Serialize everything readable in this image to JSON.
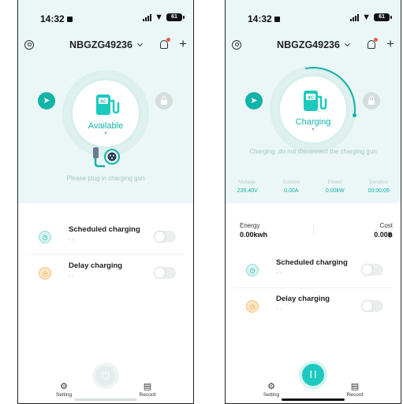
{
  "colors": {
    "accent": "#12b3a8",
    "hero_bg": "#eaf7f6",
    "disabled": "#d5dedd",
    "warning": "#f0a23a"
  },
  "left": {
    "status": {
      "time": "14:32",
      "battery": "61"
    },
    "header": {
      "device": "NBGZG49236"
    },
    "state": {
      "label": "Available",
      "badge": "AC",
      "hint": "Please plug in charging gun"
    },
    "rows": [
      {
        "title": "Scheduled charging",
        "sub": "- -",
        "icon": "clock-icon"
      },
      {
        "title": "Delay charging",
        "sub": "- -",
        "icon": "timer-icon"
      }
    ],
    "tabs": {
      "setting": "Setting",
      "record": "Record"
    }
  },
  "right": {
    "status": {
      "time": "14:32",
      "battery": "61"
    },
    "header": {
      "device": "NBGZG49236"
    },
    "state": {
      "label": "Charging",
      "badge": "AC",
      "hint": "Charging ,do not disconnect the charging gun",
      "progress": 0.3
    },
    "stats": [
      {
        "label": "Voltage",
        "value": "235.40V"
      },
      {
        "label": "Current",
        "value": "0.00A"
      },
      {
        "label": "Power",
        "value": "0.00kW"
      },
      {
        "label": "Duration",
        "value": "00:00:09"
      }
    ],
    "energy": {
      "label": "Energy",
      "value": "0.00kwh"
    },
    "cost": {
      "label": "Cost",
      "value": "0.00฿"
    },
    "rows": [
      {
        "title": "Scheduled charging",
        "sub": "- -",
        "icon": "clock-icon"
      },
      {
        "title": "Delay charging",
        "sub": "- -",
        "icon": "timer-icon"
      }
    ],
    "tabs": {
      "setting": "Setting",
      "record": "Record"
    }
  }
}
